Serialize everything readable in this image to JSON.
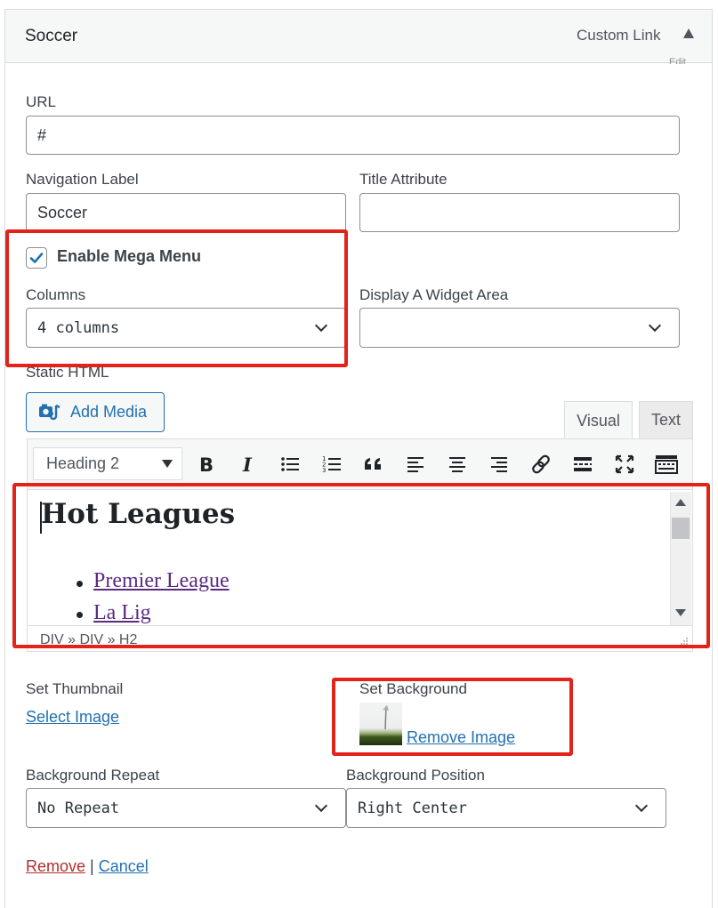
{
  "header": {
    "title": "Soccer",
    "item_type": "Custom Link",
    "edit_peek": "Edit"
  },
  "fields": {
    "url": {
      "label": "URL",
      "value": "#"
    },
    "nav_label": {
      "label": "Navigation Label",
      "value": "Soccer"
    },
    "title_attr": {
      "label": "Title Attribute",
      "value": ""
    },
    "mega_menu": {
      "label": "Enable Mega Menu",
      "checked": true
    },
    "columns": {
      "label": "Columns",
      "value": "4 columns"
    },
    "widget_area": {
      "label": "Display A Widget Area",
      "value": ""
    },
    "static_html": {
      "label": "Static HTML"
    }
  },
  "editor": {
    "add_media": "Add Media",
    "tabs": {
      "visual": "Visual",
      "text": "Text"
    },
    "format": "Heading 2",
    "toolbar_icons": [
      "bold-icon",
      "italic-icon",
      "bullet-list-icon",
      "numbered-list-icon",
      "blockquote-icon",
      "align-left-icon",
      "align-center-icon",
      "align-right-icon",
      "link-icon",
      "read-more-icon",
      "fullscreen-icon",
      "toolbar-toggle-icon"
    ],
    "content": {
      "heading": "Hot Leagues",
      "items": [
        "Premier League",
        "La Lig"
      ]
    },
    "path": "DIV » DIV » H2"
  },
  "thumbnail": {
    "label": "Set Thumbnail",
    "action": "Select Image"
  },
  "background": {
    "label": "Set Background",
    "action": "Remove Image"
  },
  "bg_repeat": {
    "label": "Background Repeat",
    "value": "No Repeat"
  },
  "bg_position": {
    "label": "Background Position",
    "value": "Right Center"
  },
  "footer": {
    "remove": "Remove",
    "separator": "|",
    "cancel": "Cancel"
  },
  "colors": {
    "accent": "#2271b1",
    "danger": "#b32d2e",
    "highlight": "#e2231a"
  }
}
